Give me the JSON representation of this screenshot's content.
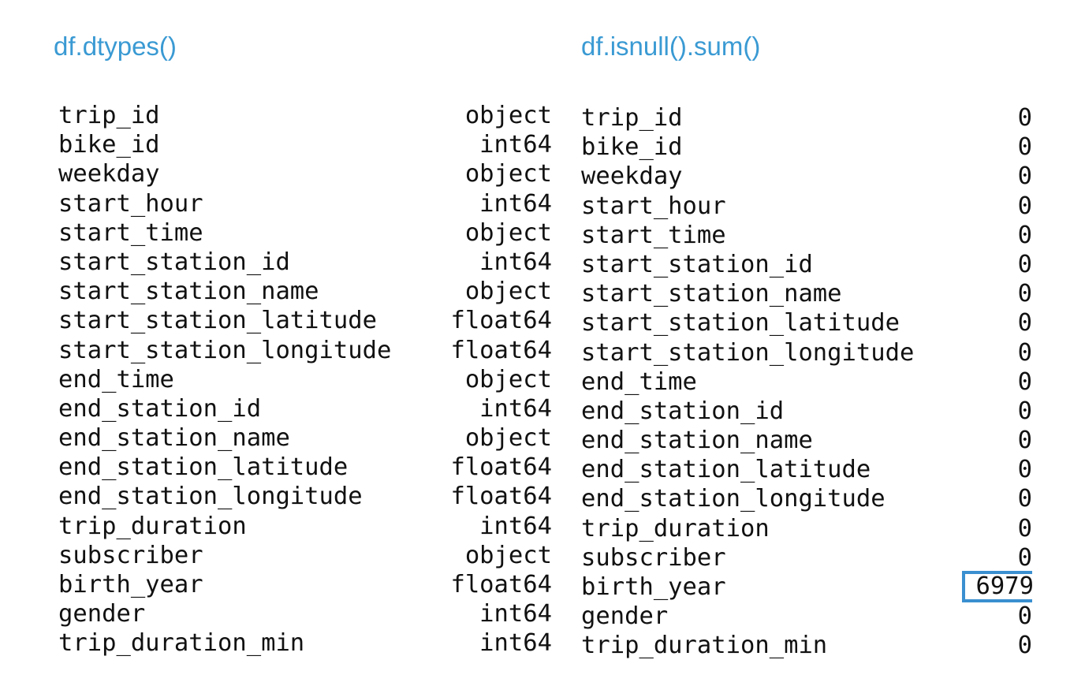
{
  "left_panel": {
    "heading": "df.dtypes()",
    "rows": [
      {
        "name": "trip_id",
        "value": "object"
      },
      {
        "name": "bike_id",
        "value": "int64"
      },
      {
        "name": "weekday",
        "value": "object"
      },
      {
        "name": "start_hour",
        "value": "int64"
      },
      {
        "name": "start_time",
        "value": "object"
      },
      {
        "name": "start_station_id",
        "value": "int64"
      },
      {
        "name": "start_station_name",
        "value": "object"
      },
      {
        "name": "start_station_latitude",
        "value": "float64"
      },
      {
        "name": "start_station_longitude",
        "value": "float64"
      },
      {
        "name": "end_time",
        "value": "object"
      },
      {
        "name": "end_station_id",
        "value": "int64"
      },
      {
        "name": "end_station_name",
        "value": "object"
      },
      {
        "name": "end_station_latitude",
        "value": "float64"
      },
      {
        "name": "end_station_longitude",
        "value": "float64"
      },
      {
        "name": "trip_duration",
        "value": "int64"
      },
      {
        "name": "subscriber",
        "value": "object"
      },
      {
        "name": "birth_year",
        "value": "float64"
      },
      {
        "name": "gender",
        "value": "int64"
      },
      {
        "name": "trip_duration_min",
        "value": "int64"
      }
    ]
  },
  "right_panel": {
    "heading": "df.isnull().sum()",
    "highlight_color": "#3a8fd0",
    "rows": [
      {
        "name": "trip_id",
        "value": "0"
      },
      {
        "name": "bike_id",
        "value": "0"
      },
      {
        "name": "weekday",
        "value": "0"
      },
      {
        "name": "start_hour",
        "value": "0"
      },
      {
        "name": "start_time",
        "value": "0"
      },
      {
        "name": "start_station_id",
        "value": "0"
      },
      {
        "name": "start_station_name",
        "value": "0"
      },
      {
        "name": "start_station_latitude",
        "value": "0"
      },
      {
        "name": "start_station_longitude",
        "value": "0"
      },
      {
        "name": "end_time",
        "value": "0"
      },
      {
        "name": "end_station_id",
        "value": "0"
      },
      {
        "name": "end_station_name",
        "value": "0"
      },
      {
        "name": "end_station_latitude",
        "value": "0"
      },
      {
        "name": "end_station_longitude",
        "value": "0"
      },
      {
        "name": "trip_duration",
        "value": "0"
      },
      {
        "name": "subscriber",
        "value": "0"
      },
      {
        "name": "birth_year",
        "value": "6979",
        "highlighted": true
      },
      {
        "name": "gender",
        "value": "0"
      },
      {
        "name": "trip_duration_min",
        "value": "0"
      }
    ]
  },
  "colors": {
    "heading": "#3a9ad3",
    "text": "#111111",
    "background": "#ffffff"
  }
}
